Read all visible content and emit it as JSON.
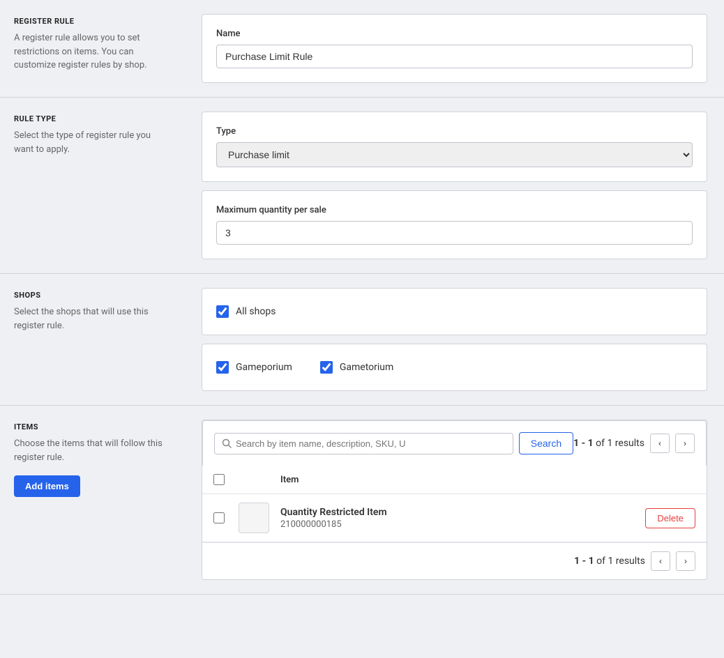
{
  "register_rule": {
    "section_title": "REGISTER RULE",
    "section_desc": "A register rule allows you to set restrictions on items. You can customize register rules by shop.",
    "name_label": "Name",
    "name_value": "Purchase Limit Rule",
    "name_placeholder": "Purchase Limit Rule"
  },
  "rule_type": {
    "section_title": "RULE TYPE",
    "section_desc": "Select the type of register rule you want to apply.",
    "type_label": "Type",
    "type_value": "Purchase limit",
    "type_options": [
      "Purchase limit"
    ],
    "max_qty_label": "Maximum quantity per sale",
    "max_qty_value": "3"
  },
  "shops": {
    "section_title": "SHOPS",
    "section_desc": "Select the shops that will use this register rule.",
    "all_shops_label": "All shops",
    "all_shops_checked": true,
    "shop_1_label": "Gameporium",
    "shop_1_checked": true,
    "shop_2_label": "Gametorium",
    "shop_2_checked": true
  },
  "items": {
    "section_title": "ITEMS",
    "section_desc": "Choose the items that will follow this register rule.",
    "add_btn_label": "Add items",
    "search_placeholder": "Search by item name, description, SKU, U",
    "search_btn_label": "Search",
    "results_text": "1 - 1 of 1 results",
    "results_bold_part": "1 - 1",
    "results_suffix": " of 1 results",
    "col_item_label": "Item",
    "item_name": "Quantity Restricted Item",
    "item_sku": "210000000185",
    "delete_btn_label": "Delete",
    "footer_results_text": "1 - 1 of 1 results",
    "footer_results_bold": "1 - 1",
    "footer_results_suffix": " of 1 results"
  },
  "icons": {
    "search": "🔍",
    "chevron_left": "‹",
    "chevron_right": "›"
  }
}
